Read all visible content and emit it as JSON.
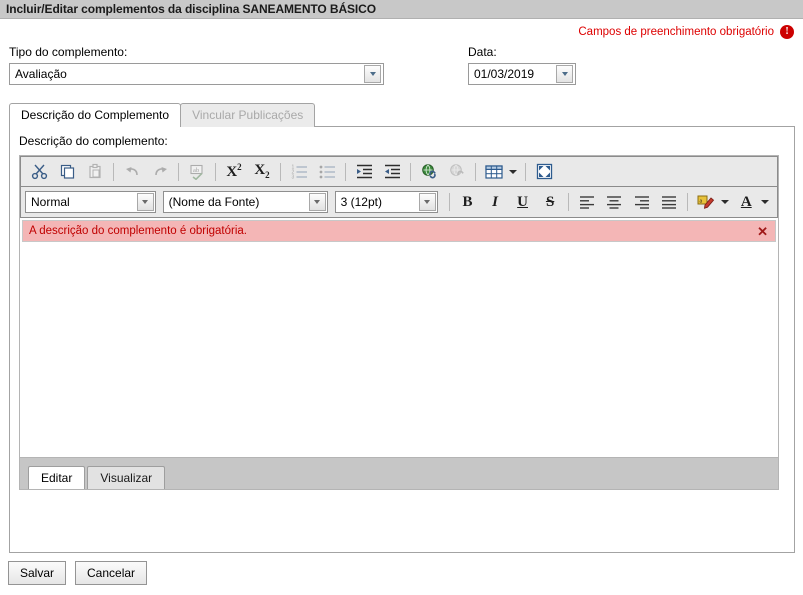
{
  "header": {
    "title": "Incluir/Editar complementos da disciplina SANEAMENTO BÁSICO"
  },
  "required_notice": {
    "text": "Campos de preenchimento obrigatório",
    "icon": "exclamation-circle-icon",
    "glyph": "!",
    "color": "#dd0000"
  },
  "form": {
    "tipo": {
      "label": "Tipo do complemento:",
      "value": "Avaliação"
    },
    "data": {
      "label": "Data:",
      "value": "01/03/2019"
    }
  },
  "tabs": [
    {
      "label": "Descrição do Complemento",
      "state": "active"
    },
    {
      "label": "Vincular Publicações",
      "state": "disabled"
    }
  ],
  "panel": {
    "label": "Descrição do complemento:"
  },
  "editor": {
    "toolbar_row1": [
      {
        "name": "cut-icon",
        "title": "Recortar"
      },
      {
        "name": "copy-icon",
        "title": "Copiar"
      },
      {
        "name": "paste-icon",
        "title": "Colar",
        "disabled": true
      },
      {
        "name": "separator"
      },
      {
        "name": "undo-icon",
        "title": "Desfazer",
        "disabled": true
      },
      {
        "name": "redo-icon",
        "title": "Refazer",
        "disabled": true
      },
      {
        "name": "separator"
      },
      {
        "name": "spellcheck-icon",
        "title": "Verificar ortografia"
      },
      {
        "name": "separator"
      },
      {
        "name": "superscript-icon",
        "title": "Sobrescrito",
        "glyph": "X"
      },
      {
        "name": "subscript-icon",
        "title": "Subscrito",
        "glyph": "X"
      },
      {
        "name": "separator"
      },
      {
        "name": "numbered-list-icon",
        "title": "Lista numerada"
      },
      {
        "name": "bulleted-list-icon",
        "title": "Lista com marcadores"
      },
      {
        "name": "separator"
      },
      {
        "name": "indent-icon",
        "title": "Aumentar recuo"
      },
      {
        "name": "outdent-icon",
        "title": "Diminuir recuo"
      },
      {
        "name": "separator"
      },
      {
        "name": "insert-link-icon",
        "title": "Inserir link"
      },
      {
        "name": "remove-link-icon",
        "title": "Remover link",
        "disabled": true
      },
      {
        "name": "separator"
      },
      {
        "name": "table-icon",
        "title": "Tabela"
      },
      {
        "name": "chevron-down-icon",
        "title": "Opções de tabela"
      },
      {
        "name": "separator"
      },
      {
        "name": "fullscreen-icon",
        "title": "Tela cheia"
      }
    ],
    "format_select": {
      "value": "Normal"
    },
    "font_select": {
      "value": "(Nome da Fonte)"
    },
    "size_select": {
      "value": "3 (12pt)"
    },
    "toolbar_row2": [
      {
        "name": "bold-icon",
        "glyph": "B"
      },
      {
        "name": "italic-icon",
        "glyph": "I"
      },
      {
        "name": "underline-icon",
        "glyph": "U"
      },
      {
        "name": "strikethrough-icon",
        "glyph": "S"
      },
      {
        "name": "align-left-icon"
      },
      {
        "name": "align-center-icon"
      },
      {
        "name": "align-right-icon"
      },
      {
        "name": "align-justify-icon"
      },
      {
        "name": "highlight-color-icon"
      },
      {
        "name": "text-color-icon",
        "glyph": "A"
      }
    ],
    "error": {
      "message": "A descrição do complemento é obrigatória.",
      "close_glyph": "✕",
      "bg_color": "#f4b6b6",
      "text_color": "#c00000"
    },
    "content": "",
    "bottom_tabs": [
      {
        "label": "Editar",
        "state": "active"
      },
      {
        "label": "Visualizar",
        "state": "inactive"
      }
    ]
  },
  "footer": {
    "save_label": "Salvar",
    "cancel_label": "Cancelar"
  }
}
